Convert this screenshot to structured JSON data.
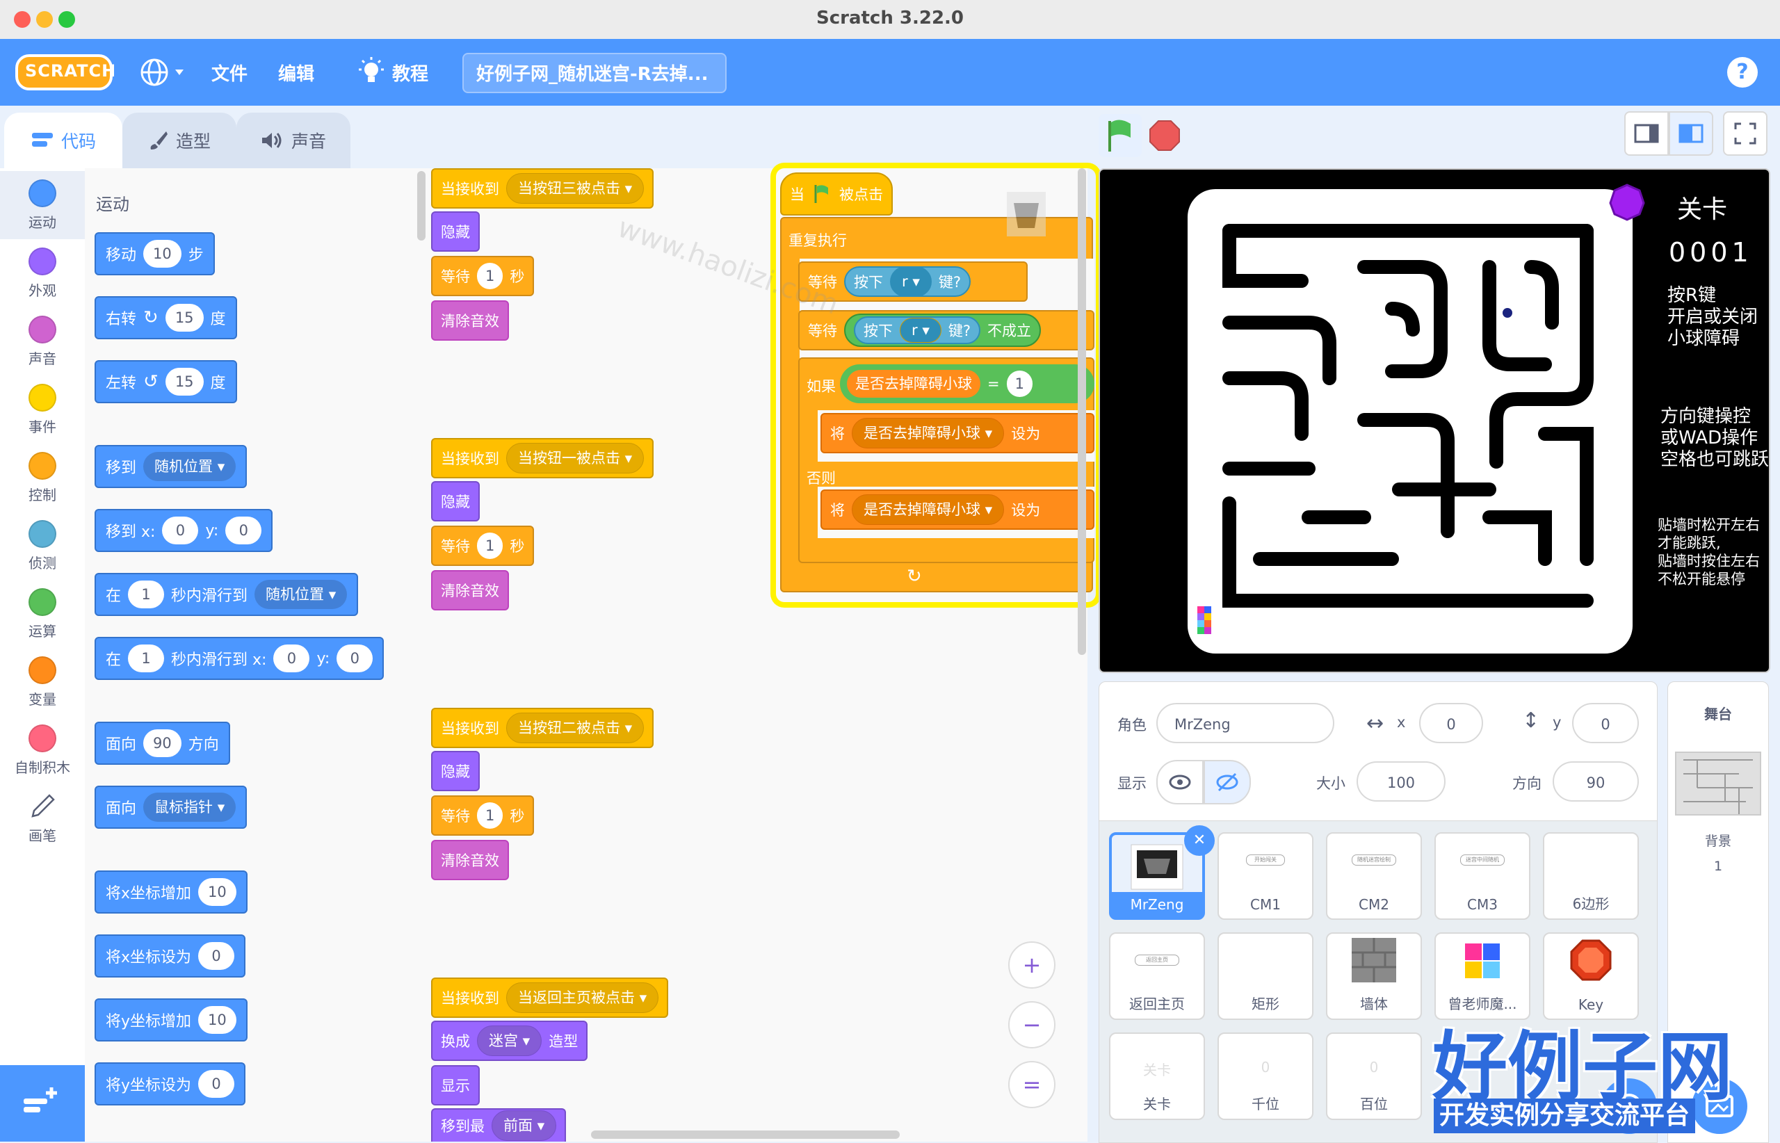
{
  "window": {
    "title": "Scratch 3.22.0"
  },
  "menubar": {
    "logo": "SCRATCH",
    "language_icon": "globe-icon",
    "file": "文件",
    "edit": "编辑",
    "tutorials": "教程",
    "project_title": "好例子网_随机迷宫-R去掉...",
    "help": "?"
  },
  "tabs": {
    "code": "代码",
    "costumes": "造型",
    "sounds": "声音"
  },
  "categories": [
    {
      "label": "运动",
      "color": "#4c97ff"
    },
    {
      "label": "外观",
      "color": "#9966ff"
    },
    {
      "label": "声音",
      "color": "#cf63cf"
    },
    {
      "label": "事件",
      "color": "#ffd500"
    },
    {
      "label": "控制",
      "color": "#ffab19"
    },
    {
      "label": "侦测",
      "color": "#5cb1d6"
    },
    {
      "label": "运算",
      "color": "#59c059"
    },
    {
      "label": "变量",
      "color": "#ff8c1a"
    },
    {
      "label": "自制积木",
      "color": "#ff6680"
    },
    {
      "label": "画笔",
      "color": "#0fbd8c"
    }
  ],
  "palette": {
    "heading": "运动",
    "move": {
      "a": "移动",
      "v": "10",
      "b": "步"
    },
    "turn_right": {
      "a": "右转",
      "v": "15",
      "b": "度"
    },
    "turn_left": {
      "a": "左转",
      "v": "15",
      "b": "度"
    },
    "goto": {
      "a": "移到",
      "d": "随机位置"
    },
    "goto_xy": {
      "a": "移到 x:",
      "x": "0",
      "yl": "y:",
      "y": "0"
    },
    "glide": {
      "a": "在",
      "v": "1",
      "b": "秒内滑行到",
      "d": "随机位置"
    },
    "glide_xy": {
      "a": "在",
      "v": "1",
      "b": "秒内滑行到 x:",
      "x": "0",
      "yl": "y:",
      "y": "0"
    },
    "point_dir": {
      "a": "面向",
      "v": "90",
      "b": "方向"
    },
    "point_towards": {
      "a": "面向",
      "d": "鼠标指针"
    },
    "change_x": {
      "a": "将x坐标增加",
      "v": "10"
    },
    "set_x": {
      "a": "将x坐标设为",
      "v": "0"
    },
    "change_y": {
      "a": "将y坐标增加",
      "v": "10"
    },
    "set_y": {
      "a": "将y坐标设为",
      "v": "0"
    }
  },
  "scripts": {
    "s1": {
      "hat": "当接收到",
      "msg": "当按钮三被点击",
      "hide": "隐藏",
      "wait": "等待",
      "wv": "1",
      "ws": "秒",
      "clear": "清除音效"
    },
    "s2": {
      "hat": "当接收到",
      "msg": "当按钮一被点击",
      "hide": "隐藏",
      "wait": "等待",
      "wv": "1",
      "ws": "秒",
      "clear": "清除音效"
    },
    "s3": {
      "hat": "当接收到",
      "msg": "当按钮二被点击",
      "hide": "隐藏",
      "wait": "等待",
      "wv": "1",
      "ws": "秒",
      "clear": "清除音效"
    },
    "s4": {
      "hat": "当接收到",
      "msg": "当返回主页被点击",
      "switch": "换成",
      "costume": "迷宫",
      "costume_b": "造型",
      "show": "显示",
      "goto_layer": "移到最",
      "layer": "前面"
    },
    "main": {
      "flag_a": "当",
      "flag_b": "被点击",
      "forever": "重复执行",
      "wait1": "等待",
      "key1": "按下",
      "key1v": "r",
      "key1b": "键?",
      "wait2": "等待",
      "key2": "按下",
      "key2v": "r",
      "key2b": "键?",
      "not": "不成立",
      "if": "如果",
      "var": "是否去掉障碍小球",
      "eq": "=",
      "eqv": "1",
      "set1": "将",
      "set1var": "是否去掉障碍小球",
      "set1b": "设为",
      "else": "否则",
      "set2": "将",
      "set2var": "是否去掉障碍小球",
      "set2b": "设为"
    }
  },
  "zoom": {
    "in": "+",
    "out": "−",
    "reset": "="
  },
  "stage": {
    "level_label": "关卡",
    "level_num": "0001",
    "hint1": [
      "按R键",
      "开启或关闭",
      "小球障碍"
    ],
    "hint2": [
      "方向键操控",
      "或WAD操作",
      "空格也可跳跃"
    ],
    "hint3": [
      "贴墙时松开左右",
      "才能跳跃,",
      "贴墙时按住左右",
      "不松开能悬停"
    ]
  },
  "sprite_info": {
    "sprite_label": "角色",
    "sprite_name": "MrZeng",
    "x_label": "x",
    "x": "0",
    "y_label": "y",
    "y": "0",
    "show_label": "显示",
    "size_label": "大小",
    "size": "100",
    "direction_label": "方向",
    "direction": "90"
  },
  "sprites": [
    "MrZeng",
    "CM1",
    "CM2",
    "CM3",
    "6边形",
    "返回主页",
    "矩形",
    "墙体",
    "曾老师魔...",
    "Key",
    "关卡",
    "千位",
    "百位"
  ],
  "sprite_thumb_text": {
    "CM1": "开始闯关",
    "CM2": "随机迷宫绘制",
    "CM3": "迷宫中间随机",
    "home": "返回主页",
    "level": "关卡",
    "thousands": "0",
    "hundreds": "0"
  },
  "stage_panel": {
    "title": "舞台",
    "backdrop_label": "背景",
    "backdrop_count": "1"
  },
  "watermark": {
    "brand": "好例子网",
    "slogan": "开发实例分享交流平台",
    "url": "www.haolizi.com"
  }
}
